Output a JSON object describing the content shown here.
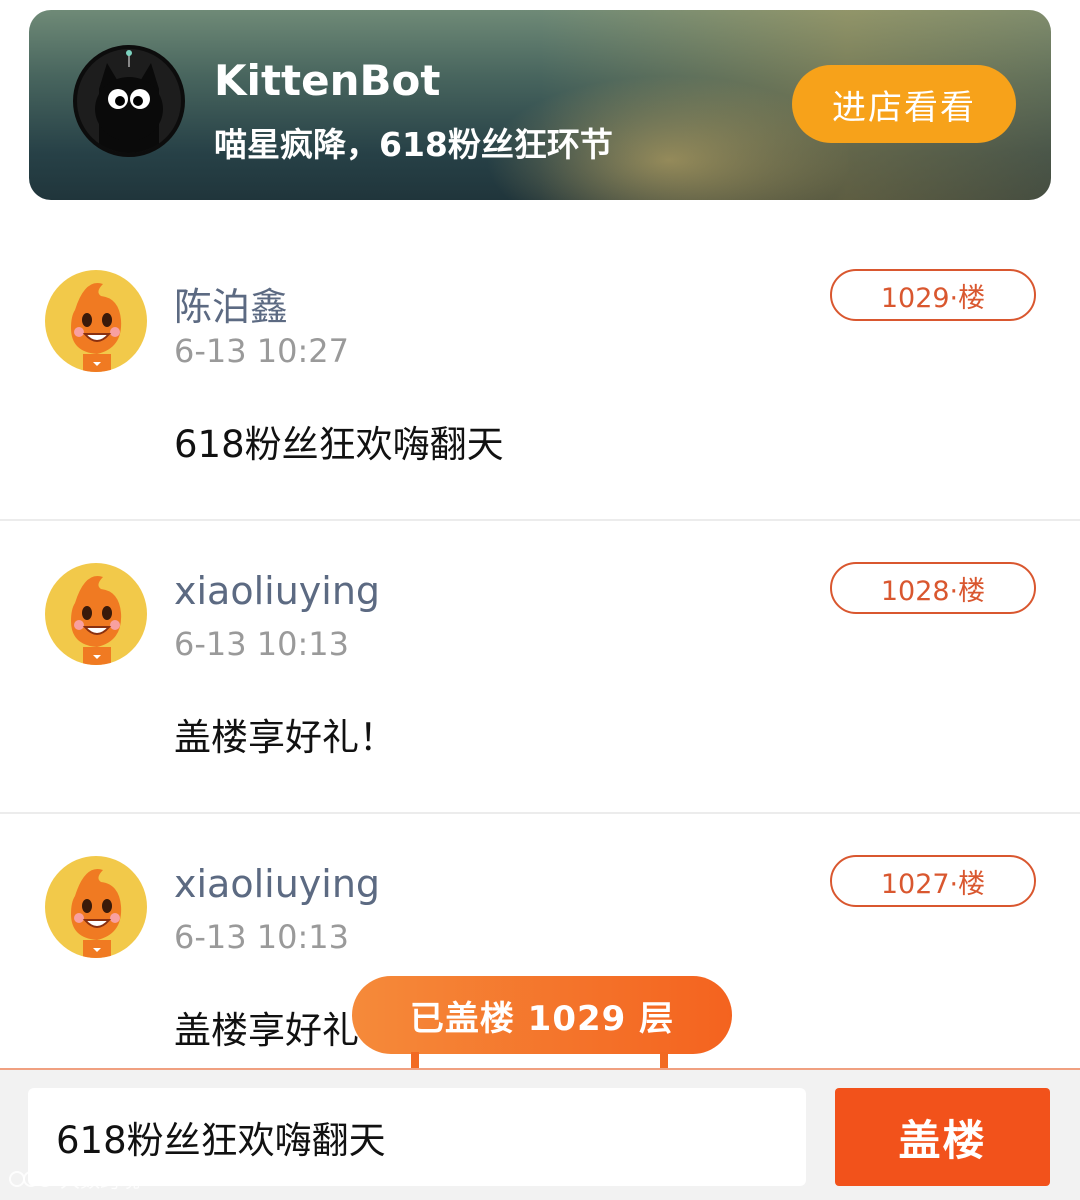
{
  "store": {
    "name": "KittenBot",
    "slogan": "喵星疯降，618粉丝狂环节",
    "visit_label": "进店看看",
    "logo_icon": "black-cat-logo-icon"
  },
  "comments": [
    {
      "username": "陈泊鑫",
      "time": "6-13 10:27",
      "text": "618粉丝狂欢嗨翻天",
      "floor": "1029·楼",
      "avatar_icon": "orange-mascot-avatar-icon"
    },
    {
      "username": "xiaoliuying",
      "time": "6-13 10:13",
      "text": "盖楼享好礼！",
      "floor": "1028·楼",
      "avatar_icon": "orange-mascot-avatar-icon"
    },
    {
      "username": "xiaoliuying",
      "time": "6-13 10:13",
      "text": "盖楼享好礼！",
      "floor": "1027·楼",
      "avatar_icon": "orange-mascot-avatar-icon"
    }
  ],
  "counter": {
    "label": "已盖楼 1029 层"
  },
  "reply": {
    "value": "618粉丝狂欢嗨翻天",
    "submit_label": "盖楼"
  },
  "watermark": {
    "text": "大数跨境"
  },
  "colors": {
    "accent": "#f2521b",
    "visit_button": "#f7a21a",
    "floor_badge": "#d9572f",
    "username": "#5c6a82"
  }
}
